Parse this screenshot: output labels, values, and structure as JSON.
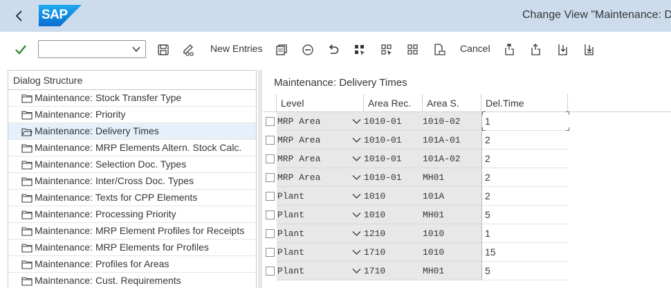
{
  "header": {
    "logo_text": "SAP",
    "title": "Change View \"Maintenance: D",
    "brand_color": "#0a6ed1"
  },
  "toolbar": {
    "combo_value": "",
    "new_entries_label": "New Entries",
    "cancel_label": "Cancel"
  },
  "dialog_structure": {
    "header": "Dialog Structure",
    "items": [
      {
        "label": "Maintenance: Stock Transfer Type",
        "selected": false
      },
      {
        "label": "Maintenance: Priority",
        "selected": false
      },
      {
        "label": "Maintenance: Delivery Times",
        "selected": true
      },
      {
        "label": "Maintenance: MRP Elements Altern. Stock Calc.",
        "selected": false
      },
      {
        "label": "Maintenance: Selection Doc. Types",
        "selected": false
      },
      {
        "label": "Maintenance: Inter/Cross Doc. Types",
        "selected": false
      },
      {
        "label": "Maintenance: Texts for CPP Elements",
        "selected": false
      },
      {
        "label": "Maintenance: Processing Priority",
        "selected": false
      },
      {
        "label": "Maintenance: MRP Element Profiles for Receipts",
        "selected": false
      },
      {
        "label": "Maintenance: MRP Elements for Profiles",
        "selected": false
      },
      {
        "label": "Maintenance: Profiles for Areas",
        "selected": false
      },
      {
        "label": "Maintenance: Cust. Requirements",
        "selected": false
      }
    ]
  },
  "panel": {
    "title": "Maintenance: Delivery Times",
    "columns": [
      "Level",
      "Area Rec.",
      "Area S.",
      "Del.Time"
    ],
    "rows": [
      {
        "level": "MRP Area",
        "area_rec": "1010-01",
        "area_s": "1010-02",
        "del_time": "1"
      },
      {
        "level": "MRP Area",
        "area_rec": "1010-01",
        "area_s": "101A-01",
        "del_time": "2"
      },
      {
        "level": "MRP Area",
        "area_rec": "1010-01",
        "area_s": "101A-02",
        "del_time": "2"
      },
      {
        "level": "MRP Area",
        "area_rec": "1010-01",
        "area_s": "MH01",
        "del_time": "2"
      },
      {
        "level": "Plant",
        "area_rec": "1010",
        "area_s": "101A",
        "del_time": "2"
      },
      {
        "level": "Plant",
        "area_rec": "1010",
        "area_s": "MH01",
        "del_time": "5"
      },
      {
        "level": "Plant",
        "area_rec": "1210",
        "area_s": "1010",
        "del_time": "1"
      },
      {
        "level": "Plant",
        "area_rec": "1710",
        "area_s": "1010",
        "del_time": "15"
      },
      {
        "level": "Plant",
        "area_rec": "1710",
        "area_s": "MH01",
        "del_time": "5"
      }
    ]
  }
}
